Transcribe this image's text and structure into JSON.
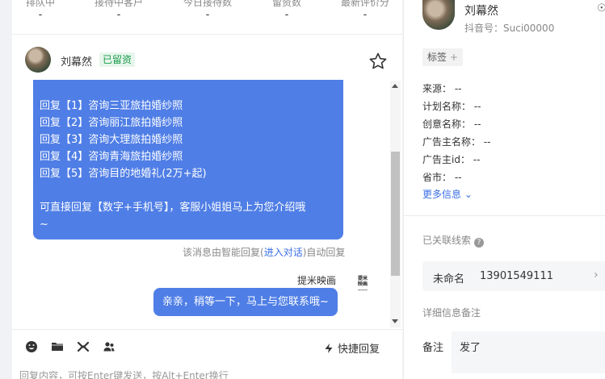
{
  "stats": [
    {
      "label": "排队中",
      "value": "-"
    },
    {
      "label": "接待中客户",
      "value": "-"
    },
    {
      "label": "今日接待数",
      "value": "-"
    },
    {
      "label": "留资数",
      "value": "-"
    },
    {
      "label": "最新评价分",
      "value": "-"
    }
  ],
  "chat": {
    "customer_name": "刘幕然",
    "status_badge": "已留资",
    "incoming_lines": [
      "回复【1】咨询三亚旅拍婚纱照",
      "回复【2】咨询丽江旅拍婚纱照",
      "回复【3】咨询大理旅拍婚纱照",
      "回复【4】咨询青海旅拍婚纱照",
      "回复【5】咨询目的地婚礼(2万+起)",
      "",
      "可直接回复【数字+手机号】，客服小姐姐马上为您介绍哦",
      "~"
    ],
    "auto_note_prefix": "该消息由智能回复(",
    "auto_note_link": "进入对话",
    "auto_note_suffix": ")自动回复",
    "sender_name": "提米映画",
    "sender_logo_text": "提米映画",
    "outgoing_message": "亲亲，稍等一下，马上与您联系哦~"
  },
  "toolbar": {
    "icons": [
      "emoji-icon",
      "folder-icon",
      "link-icon",
      "users-icon"
    ],
    "quick_reply_label": "快捷回复",
    "input_placeholder": "回复内容，可按Enter键发送，按Alt+Enter换行"
  },
  "profile": {
    "name": "刘幕然",
    "douyin_id": "抖音号：Suci00000",
    "close_symbol": "☉",
    "tag_label": "标签",
    "info_rows": [
      {
        "label": "来源：",
        "value": "--"
      },
      {
        "label": "计划名称：",
        "value": "--"
      },
      {
        "label": "创意名称：",
        "value": "--"
      },
      {
        "label": "广告主名称：",
        "value": "--"
      },
      {
        "label": "广告主id：",
        "value": "--"
      },
      {
        "label": "省市：",
        "value": "--"
      }
    ],
    "more_info_label": "更多信息",
    "linked_leads_title": "已关联线索",
    "lead": {
      "name": "未命名",
      "phone": "13901549111"
    },
    "detail_note_title": "详细信息备注",
    "note_label": "备注",
    "note_value": "发了"
  },
  "colors": {
    "bubble": "#4f7ee6",
    "badge_text": "#1a9b4a",
    "link": "#3a6ee6"
  }
}
